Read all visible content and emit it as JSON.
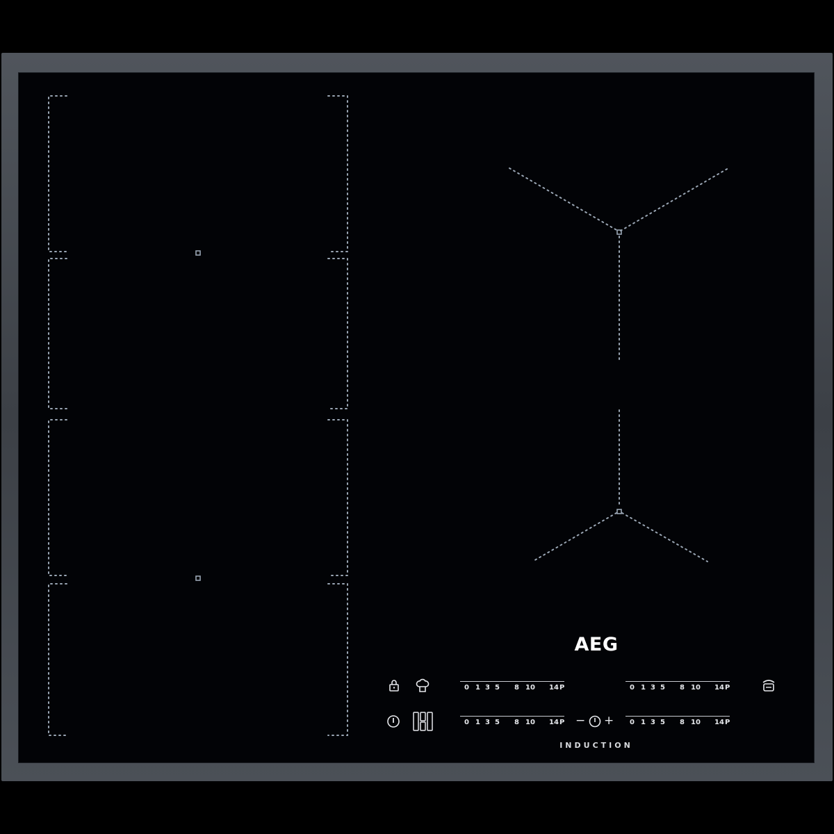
{
  "product": {
    "brand": "AEG",
    "tagline": "INDUCTION"
  },
  "colors": {
    "frame": "#464b51",
    "glass": "#020306",
    "marking": "#9aa6b4",
    "text": "#ffffff"
  },
  "controls": {
    "power_scale": [
      "0",
      "1",
      "3",
      "5",
      "8",
      "10",
      "14",
      "P"
    ],
    "sliders": [
      {
        "name": "slider-left-top"
      },
      {
        "name": "slider-right-top"
      },
      {
        "name": "slider-left-bottom"
      },
      {
        "name": "slider-right-bottom"
      }
    ],
    "timer": {
      "minus": "−",
      "plus": "+"
    },
    "icons": {
      "lock": "lock-icon",
      "chef": "chef-hat-icon",
      "power": "power-icon",
      "bridge": "bridge-zones-icon",
      "hob2hood": "hob2hood-icon",
      "timer": "timer-icon"
    }
  }
}
